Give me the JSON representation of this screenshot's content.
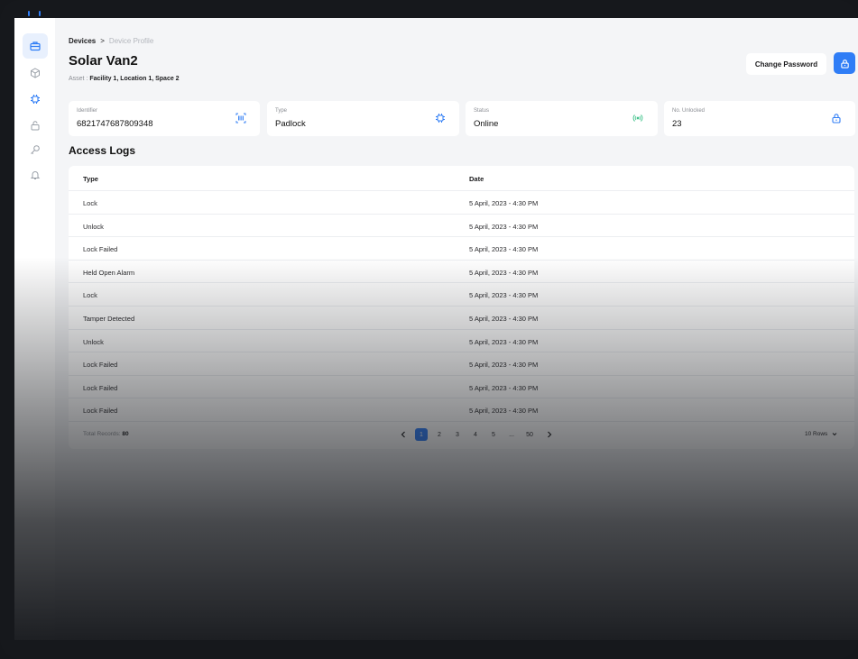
{
  "breadcrumb": {
    "parent": "Devices",
    "separator": ">",
    "current": "Device Profile"
  },
  "page": {
    "title": "Solar Van2",
    "asset_label": "Asset :",
    "asset_value": "Facility 1, Location 1, Space 2"
  },
  "actions": {
    "change_password": "Change Password"
  },
  "cards": {
    "identifier": {
      "label": "Identifier",
      "value": "6821747687809348"
    },
    "type": {
      "label": "Type",
      "value": "Padlock"
    },
    "status": {
      "label": "Status",
      "value": "Online"
    },
    "unlocked": {
      "label": "No. Unlocked",
      "value": "23"
    }
  },
  "logs": {
    "title": "Access Logs",
    "columns": {
      "type": "Type",
      "date": "Date"
    },
    "rows": [
      {
        "type": "Lock",
        "date": "5 April, 2023 - 4:30  PM"
      },
      {
        "type": "Unlock",
        "date": "5 April, 2023 - 4:30  PM"
      },
      {
        "type": "Lock Failed",
        "date": "5 April, 2023 - 4:30  PM"
      },
      {
        "type": "Held Open Alarm",
        "date": "5 April, 2023 - 4:30  PM"
      },
      {
        "type": "Lock",
        "date": "5 April, 2023 - 4:30  PM"
      },
      {
        "type": "Tamper Detected",
        "date": "5 April, 2023 - 4:30  PM"
      },
      {
        "type": "Unlock",
        "date": "5 April, 2023 - 4:30  PM"
      },
      {
        "type": "Lock Failed",
        "date": "5 April, 2023 - 4:30  PM"
      },
      {
        "type": "Lock Failed",
        "date": "5 April, 2023 - 4:30  PM"
      },
      {
        "type": "Lock Failed",
        "date": "5 April, 2023 - 4:30  PM"
      }
    ]
  },
  "footer": {
    "total_label": "Total Records:",
    "total_value": "80",
    "pages": [
      "1",
      "2",
      "3",
      "4",
      "5",
      "...",
      "50"
    ],
    "rows_per_page": "10 Rows"
  },
  "colors": {
    "accent": "#2f7df6",
    "status_online": "#3fc28a",
    "background": "#f4f5f7"
  }
}
